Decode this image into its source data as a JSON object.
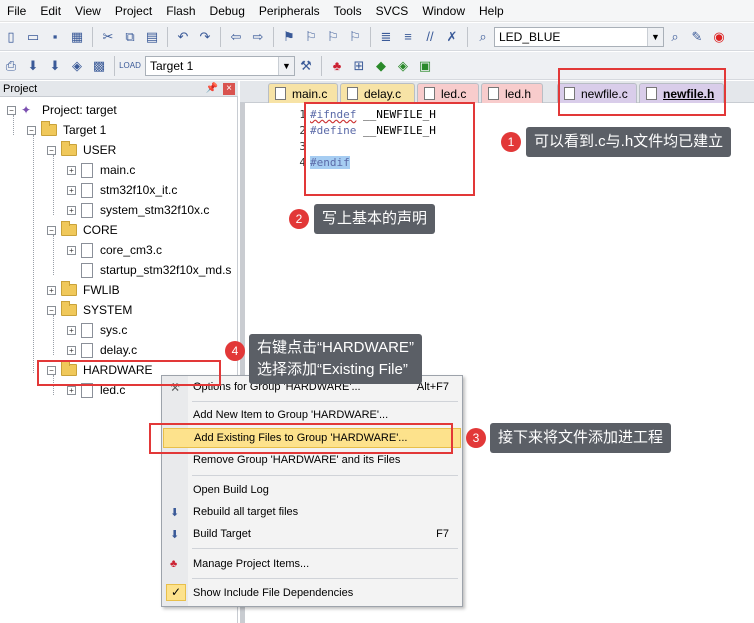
{
  "menu": [
    "File",
    "Edit",
    "View",
    "Project",
    "Flash",
    "Debug",
    "Peripherals",
    "Tools",
    "SVCS",
    "Window",
    "Help"
  ],
  "toolbar": {
    "find_combo": "LED_BLUE",
    "target_combo": "Target 1"
  },
  "project_pane": {
    "title": "Project",
    "root": "Project: target",
    "target": "Target 1",
    "groups": {
      "user": {
        "name": "USER",
        "files": [
          "main.c",
          "stm32f10x_it.c",
          "system_stm32f10x.c"
        ]
      },
      "core": {
        "name": "CORE",
        "files": [
          "core_cm3.c",
          "startup_stm32f10x_md.s"
        ]
      },
      "fwlib": {
        "name": "FWLIB"
      },
      "system": {
        "name": "SYSTEM",
        "files": [
          "sys.c",
          "delay.c"
        ]
      },
      "hardware": {
        "name": "HARDWARE",
        "files": [
          "led.c"
        ]
      }
    }
  },
  "tabs": [
    "main.c",
    "delay.c",
    "led.c",
    "led.h",
    "newfile.c",
    "newfile.h"
  ],
  "editor": {
    "lines": [
      {
        "num": "1",
        "kw": "#ifndef",
        "rest": " __NEWFILE_H"
      },
      {
        "num": "2",
        "kw": "#define",
        "rest": " __NEWFILE_H"
      },
      {
        "num": "3",
        "kw": "",
        "rest": ""
      },
      {
        "num": "4",
        "kw": "#endif",
        "rest": ""
      }
    ]
  },
  "context_menu": {
    "items": [
      {
        "label": "Options for Group 'HARDWARE'...",
        "accel": "Alt+F7"
      },
      {
        "label": "Add New  Item to Group 'HARDWARE'...",
        "accel": ""
      },
      {
        "label": "Add Existing Files to Group 'HARDWARE'...",
        "accel": ""
      },
      {
        "label": "Remove Group 'HARDWARE' and its Files",
        "accel": ""
      },
      {
        "label": "Open Build Log",
        "accel": ""
      },
      {
        "label": "Rebuild all target files",
        "accel": ""
      },
      {
        "label": "Build Target",
        "accel": "F7"
      },
      {
        "label": "Manage Project Items...",
        "accel": ""
      },
      {
        "label": "Show Include File Dependencies",
        "accel": ""
      }
    ]
  },
  "annotations": {
    "a1": {
      "num": "1",
      "text": "可以看到.c与.h文件均已建立"
    },
    "a2": {
      "num": "2",
      "text": "写上基本的声明"
    },
    "a3": {
      "num": "3",
      "text": "接下来将文件添加进工程"
    },
    "a4": {
      "num": "4",
      "line1": "右键点击“HARDWARE”",
      "line2": "选择添加“Existing File”"
    }
  },
  "colors": {
    "annotation_red": "#e23838",
    "callout_bg": "#5b5f66",
    "menu_highlight": "#fde28c"
  }
}
